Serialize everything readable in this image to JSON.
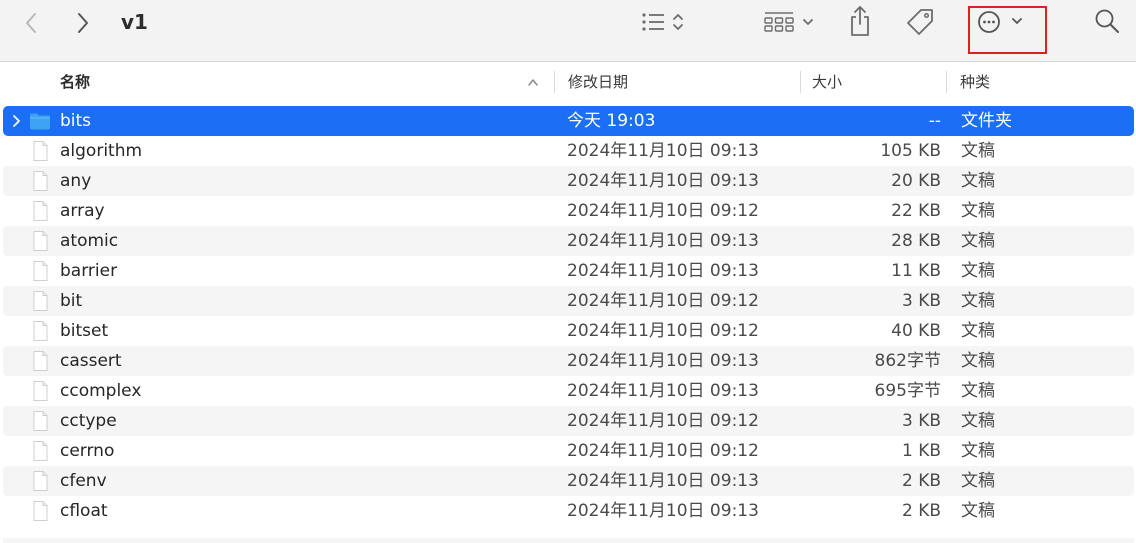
{
  "window": {
    "title": "v1"
  },
  "toolbar": {
    "back_icon": "chevron-left-icon",
    "forward_icon": "chevron-right-icon",
    "list_view_icon": "list-view-icon",
    "group_icon": "icon-grid-icon",
    "share_icon": "share-icon",
    "tag_icon": "tag-icon",
    "more_icon": "ellipsis-circle-icon",
    "search_icon": "search-icon",
    "highlight_color": "#e0201f"
  },
  "columns": {
    "name": "名称",
    "date": "修改日期",
    "size": "大小",
    "kind": "种类",
    "sort_indicator": "^"
  },
  "colors": {
    "selection": "#1a6ff4",
    "folder": "#3ea3f5"
  },
  "files": [
    {
      "name": "bits",
      "date": "今天 19:03",
      "size": "--",
      "kind": "文件夹",
      "type": "folder",
      "selected": true
    },
    {
      "name": "algorithm",
      "date": "2024年11月10日 09:13",
      "size": "105 KB",
      "kind": "文稿",
      "type": "document"
    },
    {
      "name": "any",
      "date": "2024年11月10日 09:13",
      "size": "20 KB",
      "kind": "文稿",
      "type": "document"
    },
    {
      "name": "array",
      "date": "2024年11月10日 09:12",
      "size": "22 KB",
      "kind": "文稿",
      "type": "document"
    },
    {
      "name": "atomic",
      "date": "2024年11月10日 09:13",
      "size": "28 KB",
      "kind": "文稿",
      "type": "document"
    },
    {
      "name": "barrier",
      "date": "2024年11月10日 09:13",
      "size": "11 KB",
      "kind": "文稿",
      "type": "document"
    },
    {
      "name": "bit",
      "date": "2024年11月10日 09:12",
      "size": "3 KB",
      "kind": "文稿",
      "type": "document"
    },
    {
      "name": "bitset",
      "date": "2024年11月10日 09:12",
      "size": "40 KB",
      "kind": "文稿",
      "type": "document"
    },
    {
      "name": "cassert",
      "date": "2024年11月10日 09:13",
      "size": "862字节",
      "kind": "文稿",
      "type": "document"
    },
    {
      "name": "ccomplex",
      "date": "2024年11月10日 09:13",
      "size": "695字节",
      "kind": "文稿",
      "type": "document"
    },
    {
      "name": "cctype",
      "date": "2024年11月10日 09:12",
      "size": "3 KB",
      "kind": "文稿",
      "type": "document"
    },
    {
      "name": "cerrno",
      "date": "2024年11月10日 09:12",
      "size": "1 KB",
      "kind": "文稿",
      "type": "document"
    },
    {
      "name": "cfenv",
      "date": "2024年11月10日 09:13",
      "size": "2 KB",
      "kind": "文稿",
      "type": "document"
    },
    {
      "name": "cfloat",
      "date": "2024年11月10日 09:13",
      "size": "2 KB",
      "kind": "文稿",
      "type": "document"
    }
  ]
}
